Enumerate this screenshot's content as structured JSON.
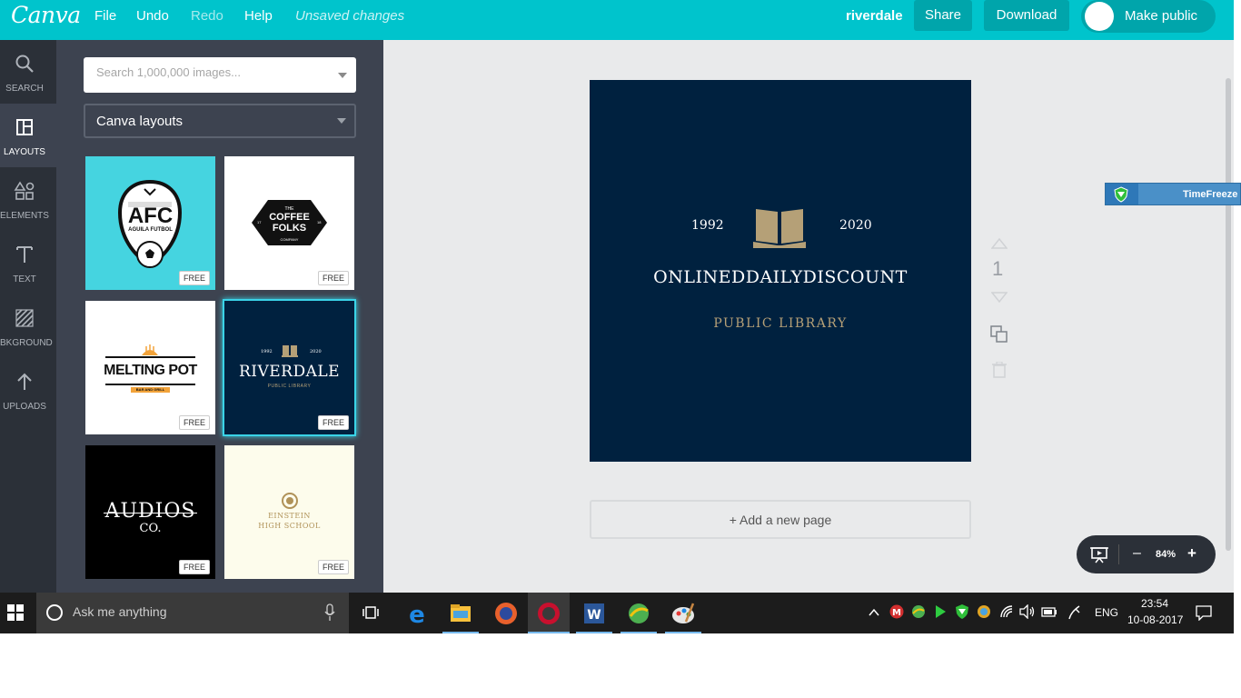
{
  "topbar": {
    "logo": "Canva",
    "menu": [
      "File",
      "Undo",
      "Redo",
      "Help"
    ],
    "status": "Unsaved changes",
    "project_name": "riverdale",
    "share_label": "Share",
    "download_label": "Download",
    "make_public_label": "Make public",
    "brand_color": "#00c4cc"
  },
  "leftnav": {
    "items": [
      {
        "label": "SEARCH",
        "icon": "search-icon"
      },
      {
        "label": "LAYOUTS",
        "icon": "layouts-icon",
        "active": true
      },
      {
        "label": "ELEMENTS",
        "icon": "shapes-icon"
      },
      {
        "label": "TEXT",
        "icon": "text-icon"
      },
      {
        "label": "BKGROUND",
        "icon": "background-icon"
      },
      {
        "label": "UPLOADS",
        "icon": "upload-arrow-icon"
      }
    ]
  },
  "panel": {
    "search_placeholder": "Search 1,000,000 images...",
    "layout_select": "Canva layouts",
    "free_badge": "FREE",
    "tiles": [
      {
        "name": "afc",
        "text": "AFC",
        "sub": "AGUILA FUTBOL"
      },
      {
        "name": "coffee-folks",
        "small_top": "THE",
        "text": "COFFEE\nFOLKS",
        "small_bottom": "COMPANY",
        "small_left": "17",
        "small_right": "18"
      },
      {
        "name": "melting-pot",
        "text": "MELTING POT",
        "sub": "BAR AND GRILL"
      },
      {
        "name": "riverdale",
        "year_left": "1992",
        "year_right": "2020",
        "text": "RIVERDALE",
        "sub": "PUBLIC LIBRARY"
      },
      {
        "name": "audios",
        "text": "AUDIOS",
        "sub": "CO."
      },
      {
        "name": "einstein",
        "text": "EINSTEIN",
        "sub": "HIGH SCHOOL"
      }
    ]
  },
  "design": {
    "year_left": "1992",
    "year_right": "2020",
    "title": "ONLINEDDAILYDISCOUNT",
    "subtitle": "PUBLIC LIBRARY",
    "background": "#00213f",
    "gold": "#b5a077"
  },
  "page_tools": {
    "page_number": "1"
  },
  "add_page_label": "+ Add a new page",
  "zoom": {
    "minus": "–",
    "value": "84%",
    "plus": "+"
  },
  "timefreeze_label": "TimeFreeze",
  "taskbar": {
    "search_text": "Ask me anything",
    "language": "ENG",
    "time": "23:54",
    "date": "10-08-2017"
  }
}
